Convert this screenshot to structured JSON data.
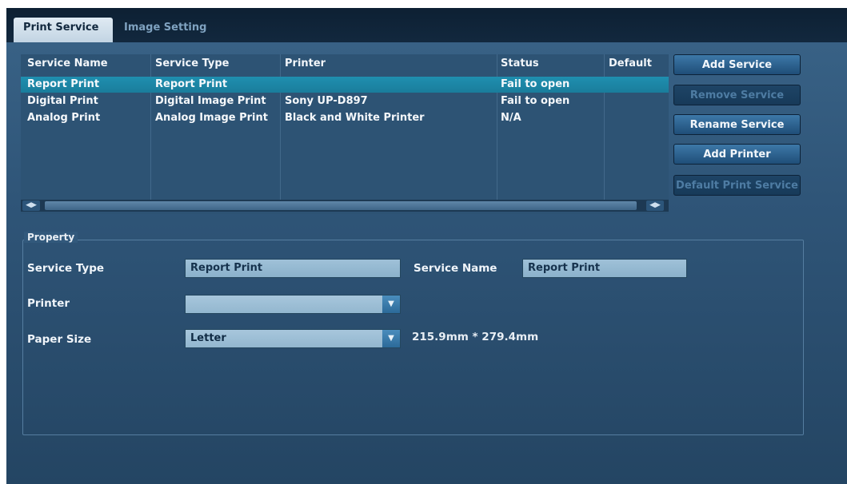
{
  "tabs": [
    {
      "label": "Print Service",
      "active": true
    },
    {
      "label": "Image Setting",
      "active": false
    }
  ],
  "table": {
    "columns": [
      "Service Name",
      "Service Type",
      "Printer",
      "Status",
      "Default"
    ],
    "rows": [
      {
        "name": "Report Print",
        "type": "Report Print",
        "printer": "",
        "status": "Fail to open",
        "default": "",
        "selected": true
      },
      {
        "name": "Digital Print",
        "type": "Digital Image Print",
        "printer": "Sony UP-D897",
        "status": "Fail to open",
        "default": ""
      },
      {
        "name": "Analog Print",
        "type": "Analog Image Print",
        "printer": "Black and White Printer",
        "status": "N/A",
        "default": ""
      }
    ],
    "scroll_left_icon": "scroll-arrows-icon",
    "scroll_right_icon": "scroll-arrows-icon"
  },
  "buttons": {
    "add_service": "Add Service",
    "remove_service": "Remove Service",
    "rename_service": "Rename Service",
    "add_printer": "Add Printer",
    "default_print_service": "Default Print Service"
  },
  "property": {
    "title": "Property",
    "service_type_label": "Service Type",
    "service_type_value": "Report Print",
    "service_name_label": "Service Name",
    "service_name_value": "Report Print",
    "printer_label": "Printer",
    "printer_value": "",
    "paper_size_label": "Paper Size",
    "paper_size_value": "Letter",
    "paper_size_dims": "215.9mm * 279.4mm"
  }
}
